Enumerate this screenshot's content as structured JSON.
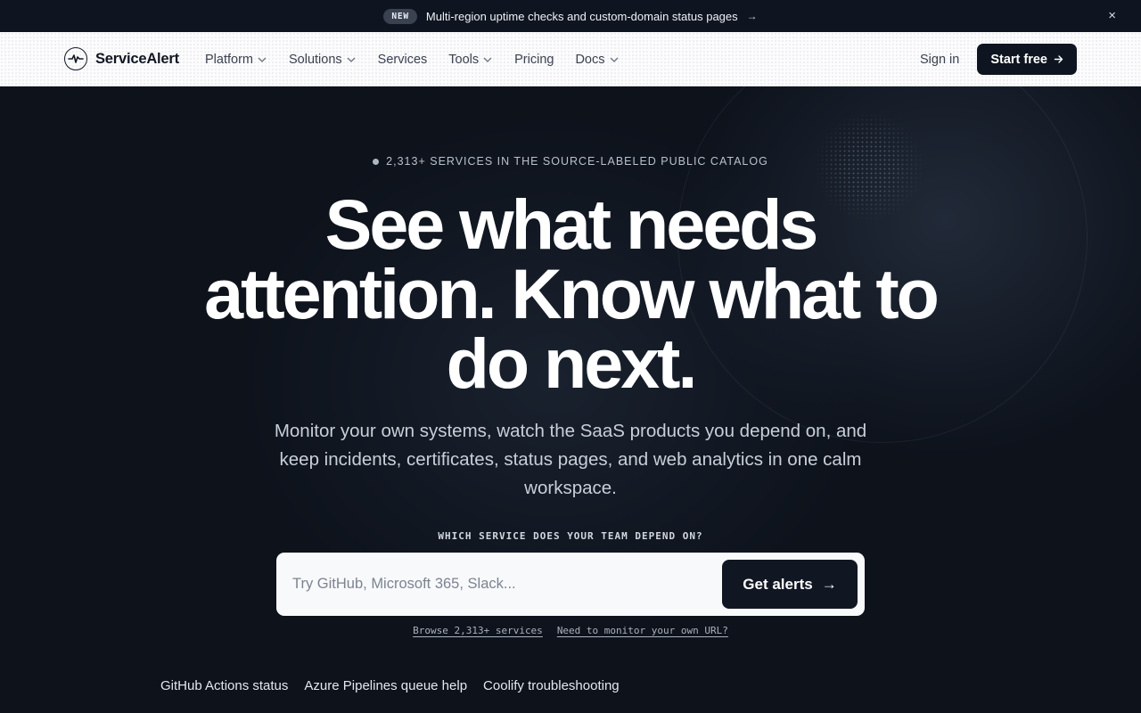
{
  "announcement": {
    "badge": "NEW",
    "message": "Multi-region uptime checks and custom-domain status pages",
    "arrow": "→",
    "close": "×"
  },
  "nav": {
    "logo_text": "ServiceAlert",
    "items": [
      {
        "label": "Platform",
        "dropdown": true
      },
      {
        "label": "Solutions",
        "dropdown": true
      },
      {
        "label": "Services",
        "dropdown": false
      },
      {
        "label": "Tools",
        "dropdown": true
      },
      {
        "label": "Pricing",
        "dropdown": false
      },
      {
        "label": "Docs",
        "dropdown": true
      }
    ],
    "signin": "Sign in",
    "start_free": "Start free"
  },
  "hero": {
    "eyebrow": "2,313+ services in the source-labeled public catalog",
    "headline": "See what needs attention. Know what to do next.",
    "subhead": "Monitor your own systems, watch the SaaS products you depend on, and keep incidents, certificates, status pages, and web analytics in one calm workspace.",
    "question": "WHICH SERVICE DOES YOUR TEAM DEPEND ON?",
    "search_placeholder": "Try GitHub, Microsoft 365, Slack...",
    "cta": "Get alerts",
    "cta_arrow": "→",
    "links": [
      "Browse 2,313+ services",
      "Need to monitor your own URL?"
    ],
    "chips": [
      "GitHub Actions status",
      "Azure Pipelines queue help",
      "Coolify troubleshooting"
    ]
  },
  "colors": {
    "hero_bg": "#0d121b",
    "nav_bg": "#fcfcfd",
    "button_dark": "#111722"
  }
}
